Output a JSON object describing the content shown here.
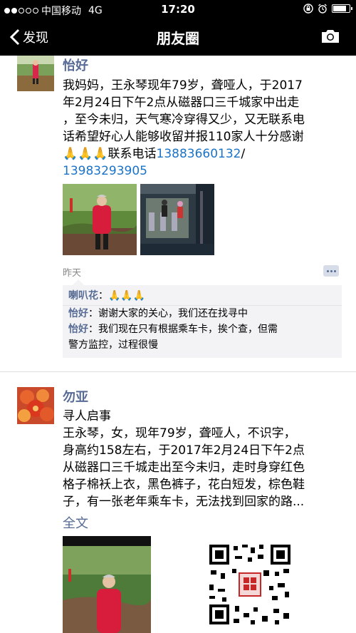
{
  "status_bar": {
    "carrier": "中国移动",
    "network": "4G",
    "time": "17:20",
    "battery_level": 0.85,
    "icons": [
      "lock-rotation-icon",
      "alarm-icon",
      "battery-icon"
    ]
  },
  "navbar": {
    "back_label": "发现",
    "title": "朋友圈",
    "back_icon": "chevron-left-icon",
    "camera_icon": "camera-icon"
  },
  "posts": [
    {
      "author": "怡好",
      "text_lines": [
        "我妈妈，王永琴现年79岁，聋哑人，于2017",
        "年2月24日下午2点从磁器口三千城家中出走",
        "，至今未归，天气寒冷穿得又少，又无联系电",
        "话希望好心人能够收留并报110家人十分感谢"
      ],
      "emoji_line_prefix": "🙏🙏🙏",
      "contact_label": "联系电话",
      "phone1": "13883660132",
      "phone_sep": "/",
      "phone2": "13983293905",
      "time": "昨天",
      "comments": [
        {
          "name": "喇叭花",
          "text": "🙏🙏🙏"
        },
        {
          "name": "怡好",
          "text": "谢谢大家的关心，我们还在找寻中"
        },
        {
          "name": "怡好",
          "text": "我们现在只有根据乘车卡，挨个查，但需"
        },
        {
          "name": "",
          "text": "警方监控，过程很慢"
        }
      ]
    },
    {
      "author": "勿亚",
      "text_lines": [
        "寻人启事",
        "王永琴，女，现年79岁，聋哑人，不识字，",
        "身高约158左右，于2017年2月24日下午2点",
        "从磁器口三千城走出至今未归，走时身穿红色",
        "格子棉袄上衣，黑色裤子，花白短发，棕色鞋",
        "子，有一张老年乘车卡，无法找到回家的路..."
      ],
      "full_text_label": "全文"
    }
  ],
  "colors": {
    "name_blue": "#576b95",
    "link_blue": "#1a73c8",
    "bar_black": "#000000"
  }
}
